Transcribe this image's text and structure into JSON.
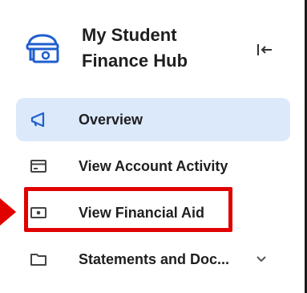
{
  "sidebar": {
    "title_line1": "My Student",
    "title_line2": "Finance Hub",
    "collapse_icon": "collapse-left-icon",
    "items": [
      {
        "label": "Overview",
        "icon": "megaphone-icon",
        "active": true
      },
      {
        "label": "View Account Activity",
        "icon": "card-icon",
        "active": false
      },
      {
        "label": "View Financial Aid",
        "icon": "cash-icon",
        "active": false,
        "highlighted": true
      },
      {
        "label": "Statements and Doc...",
        "icon": "folder-icon",
        "active": false,
        "expandable": true
      }
    ]
  },
  "colors": {
    "active_bg": "#dce9fb",
    "accent_blue": "#1f5fcf",
    "highlight_red": "#e00000"
  }
}
